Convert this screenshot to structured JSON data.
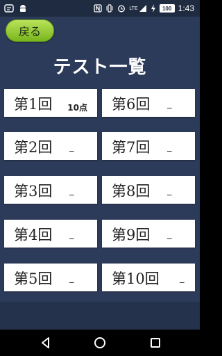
{
  "status_bar": {
    "left_icons": [
      "settings-notification-icon",
      "android-notification-icon"
    ],
    "right_icons": [
      "nfc-icon",
      "vibrate-icon",
      "alarm-icon",
      "lte-signal-icon",
      "charging-icon"
    ],
    "network": "LTE",
    "battery_level": "100",
    "time": "1:43"
  },
  "header": {
    "back_label": "戻る",
    "title": "テスト一覧"
  },
  "tests": [
    {
      "label": "第1回",
      "score": "10点"
    },
    {
      "label": "第6回",
      "score": "_"
    },
    {
      "label": "第2回",
      "score": "_"
    },
    {
      "label": "第7回",
      "score": "_"
    },
    {
      "label": "第3回",
      "score": "_"
    },
    {
      "label": "第8回",
      "score": "_"
    },
    {
      "label": "第4回",
      "score": "_"
    },
    {
      "label": "第9回",
      "score": "_"
    },
    {
      "label": "第5回",
      "score": "_"
    },
    {
      "label": "第10回",
      "score": "_"
    }
  ],
  "navigation": {
    "icons": [
      "back-triangle-icon",
      "home-circle-icon",
      "recents-square-icon"
    ]
  },
  "colors": {
    "background": "#2d3b5a",
    "status_bar": "#1f2b40",
    "back_button": "#8fc63a",
    "card": "#ffffff"
  }
}
